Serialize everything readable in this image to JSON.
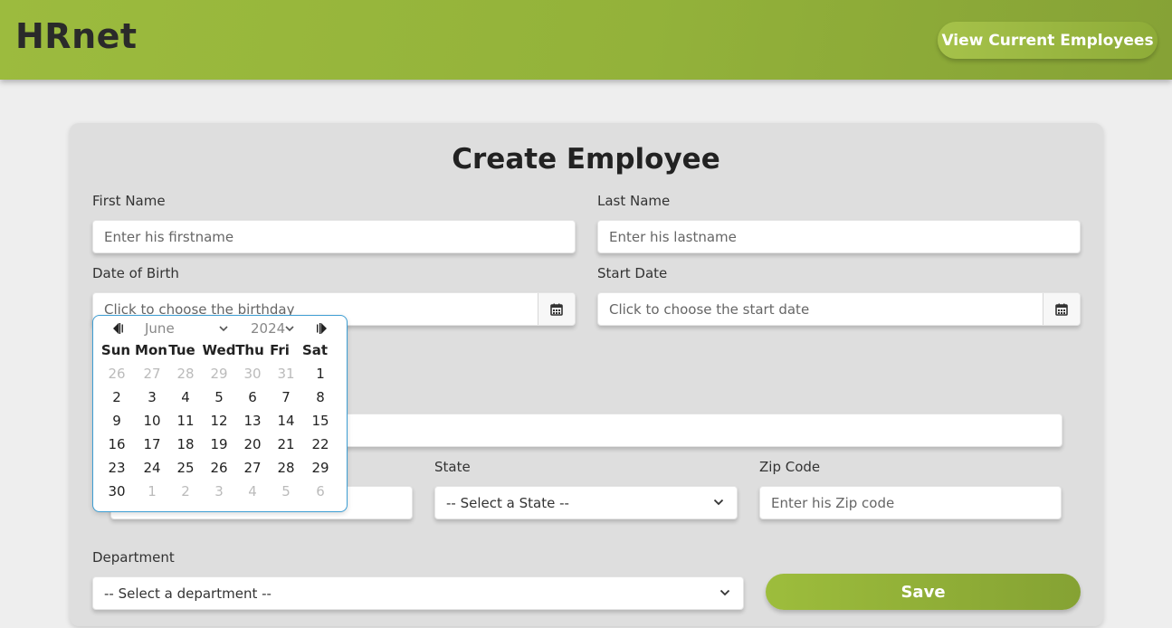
{
  "header": {
    "logo": "HRnet",
    "view_employees_label": "View Current Employees"
  },
  "form": {
    "title": "Create Employee",
    "first_name": {
      "label": "First Name",
      "placeholder": "Enter his firstname",
      "value": ""
    },
    "last_name": {
      "label": "Last Name",
      "placeholder": "Enter his lastname",
      "value": ""
    },
    "date_of_birth": {
      "label": "Date of Birth",
      "placeholder": "Click to choose the birthday",
      "value": ""
    },
    "start_date": {
      "label": "Start Date",
      "placeholder": "Click to choose the start date",
      "value": ""
    },
    "state": {
      "label": "State",
      "selected": "-- Select a State --"
    },
    "zip": {
      "label": "Zip Code",
      "placeholder": "Enter his Zip code",
      "value": ""
    },
    "department": {
      "label": "Department",
      "selected": "-- Select a department --"
    },
    "save_label": "Save"
  },
  "datepicker": {
    "month": "June",
    "year": "2024",
    "weekdays": [
      "Sun",
      "Mon",
      "Tue",
      "Wed",
      "Thu",
      "Fri",
      "Sat"
    ],
    "weeks": [
      [
        {
          "d": "26",
          "muted": true
        },
        {
          "d": "27",
          "muted": true
        },
        {
          "d": "28",
          "muted": true
        },
        {
          "d": "29",
          "muted": true
        },
        {
          "d": "30",
          "muted": true
        },
        {
          "d": "31",
          "muted": true
        },
        {
          "d": "1",
          "muted": false
        }
      ],
      [
        {
          "d": "2",
          "muted": false
        },
        {
          "d": "3",
          "muted": false
        },
        {
          "d": "4",
          "muted": false
        },
        {
          "d": "5",
          "muted": false
        },
        {
          "d": "6",
          "muted": false
        },
        {
          "d": "7",
          "muted": false
        },
        {
          "d": "8",
          "muted": false
        }
      ],
      [
        {
          "d": "9",
          "muted": false
        },
        {
          "d": "10",
          "muted": false
        },
        {
          "d": "11",
          "muted": false
        },
        {
          "d": "12",
          "muted": false
        },
        {
          "d": "13",
          "muted": false
        },
        {
          "d": "14",
          "muted": false
        },
        {
          "d": "15",
          "muted": false
        }
      ],
      [
        {
          "d": "16",
          "muted": false
        },
        {
          "d": "17",
          "muted": false
        },
        {
          "d": "18",
          "muted": false
        },
        {
          "d": "19",
          "muted": false
        },
        {
          "d": "20",
          "muted": false
        },
        {
          "d": "21",
          "muted": false
        },
        {
          "d": "22",
          "muted": false
        }
      ],
      [
        {
          "d": "23",
          "muted": false
        },
        {
          "d": "24",
          "muted": false
        },
        {
          "d": "25",
          "muted": false
        },
        {
          "d": "26",
          "muted": false
        },
        {
          "d": "27",
          "muted": false
        },
        {
          "d": "28",
          "muted": false
        },
        {
          "d": "29",
          "muted": false
        }
      ],
      [
        {
          "d": "30",
          "muted": false
        },
        {
          "d": "1",
          "muted": true
        },
        {
          "d": "2",
          "muted": true
        },
        {
          "d": "3",
          "muted": true
        },
        {
          "d": "4",
          "muted": true
        },
        {
          "d": "5",
          "muted": true
        },
        {
          "d": "6",
          "muted": true
        }
      ]
    ]
  },
  "icons": {
    "calendar": "calendar-icon",
    "chevron": "chevron-down-icon",
    "prev": "prev-month-icon",
    "next": "next-month-icon"
  },
  "colors": {
    "brand_green": "#93b23a",
    "picker_border": "#3e9ed3"
  }
}
